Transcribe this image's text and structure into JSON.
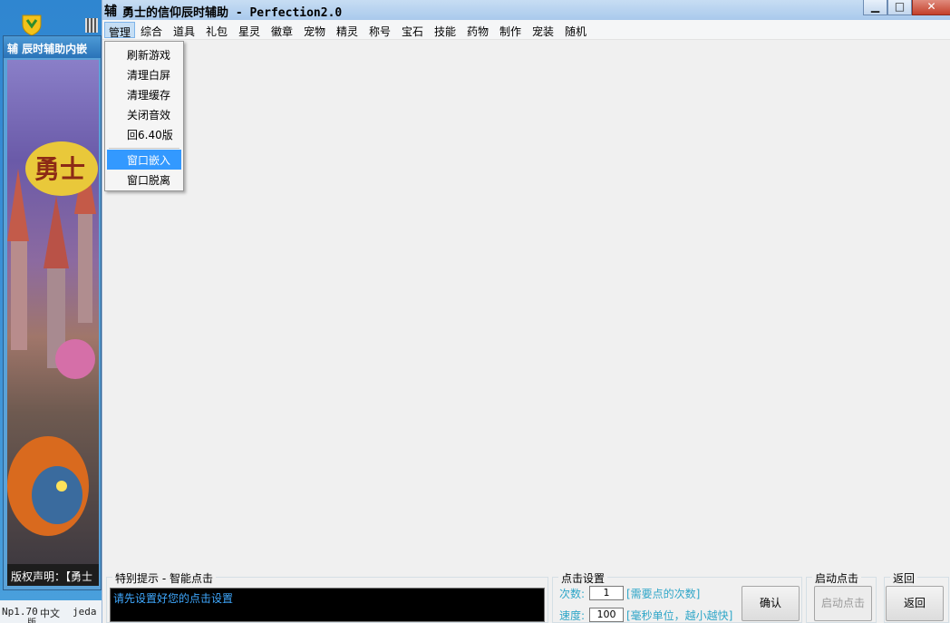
{
  "back_window": {
    "title": "辅 辰时辅助内嵌",
    "footer": "版权声明：【勇士"
  },
  "taskbar": {
    "version": "Np1.70",
    "lang": "中文",
    "extra": "jeda",
    "tail": "版"
  },
  "window": {
    "icon": "辅",
    "title": "勇士的信仰辰时辅助 - Perfection2.0",
    "min": "▁",
    "max": "□",
    "close": "✕"
  },
  "menu": [
    "管理",
    "综合",
    "道具",
    "礼包",
    "星灵",
    "徽章",
    "宠物",
    "精灵",
    "称号",
    "宝石",
    "技能",
    "药物",
    "制作",
    "宠装",
    "随机"
  ],
  "dropdown": [
    "刷新游戏",
    "清理白屏",
    "清理缓存",
    "关闭音效",
    "回6.40版",
    "窗口嵌入",
    "窗口脱离"
  ],
  "tips_group": {
    "label": "特别提示 - 智能点击",
    "text": "请先设置好您的点击设置"
  },
  "click_group": {
    "label": "点击设置",
    "count_label": "次数:",
    "count_value": "1",
    "count_hint": "[需要点的次数]",
    "speed_label": "速度:",
    "speed_value": "100",
    "speed_hint": "[毫秒单位，越小越快]",
    "confirm": "确认"
  },
  "start_group": {
    "label": "启动点击",
    "button": "启动点击"
  },
  "back_group": {
    "label": "返回",
    "button": "返回"
  },
  "colors": {
    "accent": "#3399ff",
    "hint": "#2fa6c8"
  }
}
